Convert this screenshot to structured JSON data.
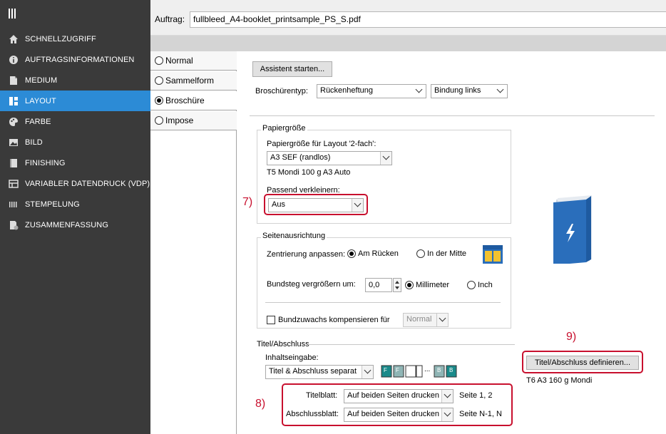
{
  "sidebar": {
    "items": [
      {
        "label": "SCHNELLZUGRIFF",
        "icon": "home-icon"
      },
      {
        "label": "AUFTRAGSINFORMATIONEN",
        "icon": "info-icon"
      },
      {
        "label": "MEDIUM",
        "icon": "paper-icon"
      },
      {
        "label": "LAYOUT",
        "icon": "layout-icon"
      },
      {
        "label": "FARBE",
        "icon": "palette-icon"
      },
      {
        "label": "BILD",
        "icon": "image-icon"
      },
      {
        "label": "FINISHING",
        "icon": "finishing-icon"
      },
      {
        "label": "VARIABLER DATENDRUCK (VDP)",
        "icon": "vdp-icon"
      },
      {
        "label": "STEMPELUNG",
        "icon": "stamp-icon"
      },
      {
        "label": "ZUSAMMENFASSUNG",
        "icon": "summary-icon"
      }
    ],
    "active_color": "#2c8bd6"
  },
  "job": {
    "label": "Auftrag:",
    "filename": "fullbleed_A4-booklet_printsample_PS_S.pdf"
  },
  "tabs": [
    {
      "label": "Normal",
      "selected": false
    },
    {
      "label": "Sammelform",
      "selected": false
    },
    {
      "label": "Broschüre",
      "selected": true
    },
    {
      "label": "Impose",
      "selected": false
    }
  ],
  "wizard_button": "Assistent starten...",
  "booklet": {
    "type_label": "Broschürentyp:",
    "type_value": "Rückenheftung",
    "binding_value": "Bindung links"
  },
  "paper_size": {
    "title": "Papiergröße",
    "size_label": "Papiergröße für Layout '2-fach':",
    "size_value": "A3 SEF (randlos)",
    "media_info": "T5 Mondi 100 g A3 Auto",
    "shrink_label": "Passend verkleinern:",
    "shrink_value": "Aus"
  },
  "orientation": {
    "title": "Seitenausrichtung",
    "center_label": "Zentrierung anpassen:",
    "center_options": [
      "Am Rücken",
      "In der Mitte"
    ],
    "gutter_label": "Bundsteg vergrößern um:",
    "gutter_value": "0,0",
    "unit_options": [
      "Millimeter",
      "Inch"
    ],
    "creep_label": "Bundzuwachs kompensieren für",
    "creep_value": "Normal"
  },
  "cover": {
    "title": "Titel/Abschluss",
    "input_label": "Inhaltseingabe:",
    "input_value": "Titel & Abschluss separat",
    "define_button": "Titel/Abschluss definieren...",
    "media_info": "T6 A3 160 g Mondi",
    "front_label": "Titelblatt:",
    "front_value": "Auf beiden Seiten drucken",
    "front_pages": "Seite 1, 2",
    "back_label": "Abschlussblatt:",
    "back_value": "Auf beiden Seiten drucken",
    "back_pages": "Seite N-1, N",
    "page_icon_letters": [
      "F",
      "F",
      "B",
      "B"
    ],
    "page_dots": "..."
  },
  "annotations": {
    "label7": "7)",
    "label8": "8)",
    "label9": "9)"
  },
  "colors": {
    "sidebar_bg": "#3a3a3a",
    "highlight_red": "#c8102e",
    "booklet_blue": "#2a6ebb",
    "page_teal": "#1a8a8a"
  }
}
